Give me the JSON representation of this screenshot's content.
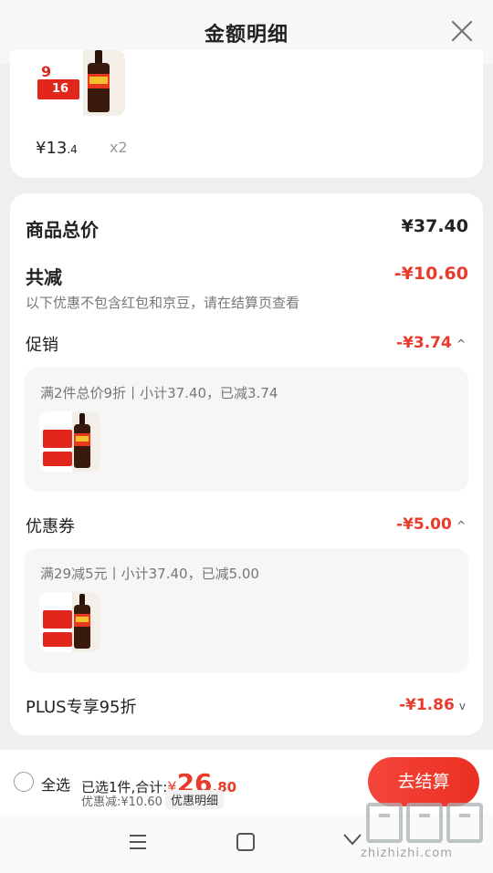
{
  "header": {
    "title": "金额明细",
    "close_icon": "close-icon"
  },
  "top_item": {
    "thumb_badge": "9",
    "thumb_price": "16",
    "price_main": "¥13",
    "price_dec": ".4",
    "qty": "x2"
  },
  "summary": {
    "goods_total_label": "商品总价",
    "goods_total_value": "¥37.40",
    "reduce_label": "共减",
    "reduce_value": "-¥10.60",
    "reduce_note": "以下优惠不包含红包和京豆，请在结算页查看"
  },
  "promo": {
    "label": "促销",
    "value": "-¥3.74",
    "chevron": "^",
    "detail": "满2件总价9折丨小计37.40，已减3.74"
  },
  "coupon": {
    "label": "优惠券",
    "value": "-¥5.00",
    "chevron": "^",
    "detail": "满29减5元丨小计37.40，已减5.00"
  },
  "plus": {
    "label": "PLUS专享95折",
    "value": "-¥1.86",
    "chevron": "v"
  },
  "bottom": {
    "select_all": "全选",
    "selected_text": "已选1件,合计:",
    "yen": "¥",
    "total_int": "26",
    "total_dec": ".80",
    "discount_text": "优惠减:¥10.60",
    "detail_link": "优惠明细",
    "checkout": "去结算"
  },
  "watermark": {
    "text": "zhizhizhi.com"
  },
  "colors": {
    "accent": "#e93b2c",
    "background": "#efefef"
  }
}
